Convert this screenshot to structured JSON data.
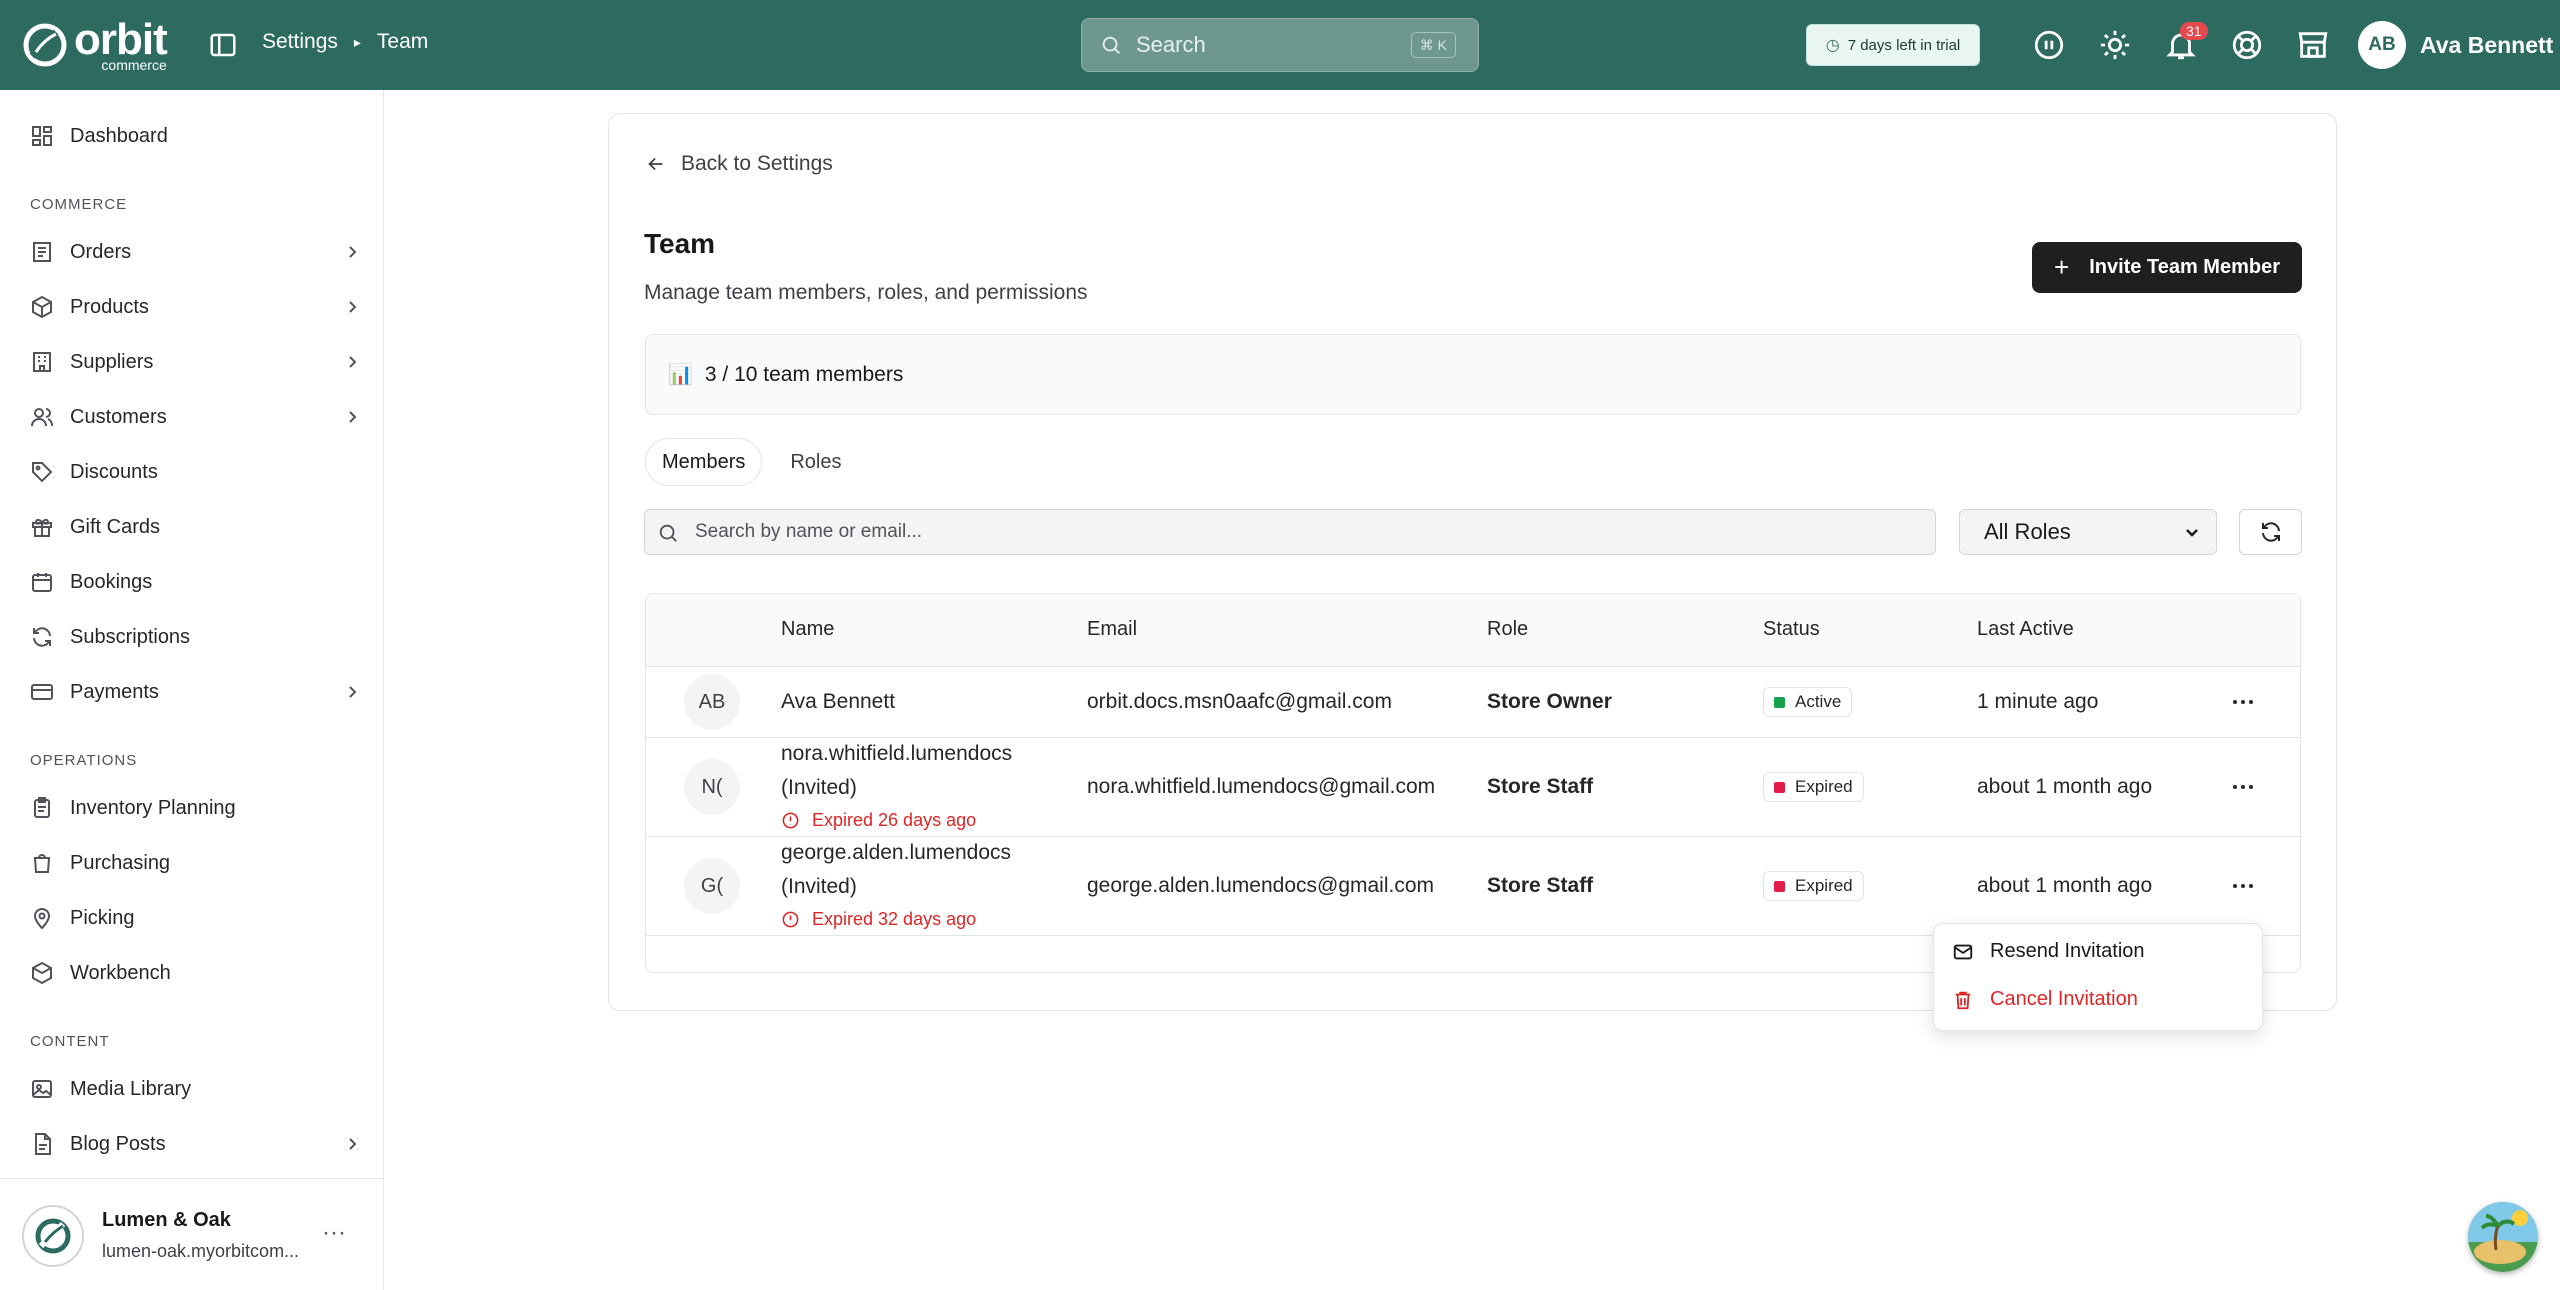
{
  "topbar": {
    "logo_word": "orbit",
    "logo_sub": "commerce",
    "breadcrumb": [
      "Settings",
      "Team"
    ],
    "search_placeholder": "Search",
    "search_shortcut": "⌘ K",
    "trial_text": "7 days left in trial",
    "notification_count": "31",
    "user_initials": "AB",
    "user_name": "Ava Bennett"
  },
  "sidebar": {
    "dashboard": "Dashboard",
    "section_commerce": "COMMERCE",
    "commerce_items": [
      "Orders",
      "Products",
      "Suppliers",
      "Customers",
      "Discounts",
      "Gift Cards",
      "Bookings",
      "Subscriptions",
      "Payments"
    ],
    "section_operations": "OPERATIONS",
    "operations_items": [
      "Inventory Planning",
      "Purchasing",
      "Picking",
      "Workbench"
    ],
    "section_content": "CONTENT",
    "content_items": [
      "Media Library",
      "Blog Posts"
    ],
    "store_name": "Lumen & Oak",
    "store_url": "lumen-oak.myorbitcom..."
  },
  "main": {
    "back_label": "Back to Settings",
    "title": "Team",
    "subtitle": "Manage team members, roles, and permissions",
    "invite_label": "Invite Team Member",
    "usage_icon": "📊",
    "usage_text": "3 / 10 team members",
    "tabs": [
      "Members",
      "Roles"
    ],
    "search_placeholder": "Search by name or email...",
    "role_filter": "All Roles",
    "columns": [
      "Name",
      "Email",
      "Role",
      "Status",
      "Last Active"
    ],
    "rows": [
      {
        "initials": "AB",
        "name": "Ava Bennett",
        "email": "orbit.docs.msn0aafc@gmail.com",
        "role": "Store Owner",
        "status": "Active",
        "last_active": "1 minute ago"
      },
      {
        "initials": "N(",
        "name_line1": "nora.whitfield.lumendocs",
        "name_line2": "(Invited)",
        "expired": "Expired 26 days ago",
        "email": "nora.whitfield.lumendocs@gmail.com",
        "role": "Store Staff",
        "status": "Expired",
        "last_active": "about 1 month ago"
      },
      {
        "initials": "G(",
        "name_line1": "george.alden.lumendocs",
        "name_line2": "(Invited)",
        "expired": "Expired 32 days ago",
        "email": "george.alden.lumendocs@gmail.com",
        "role": "Store Staff",
        "status": "Expired",
        "last_active": "about 1 month ago"
      }
    ]
  },
  "menu": {
    "resend": "Resend Invitation",
    "cancel": "Cancel Invitation"
  },
  "colors": {
    "brand": "#2d6a5f",
    "active_dot": "#16a34a",
    "expired_dot": "#e11d48",
    "danger": "#dc2626"
  }
}
